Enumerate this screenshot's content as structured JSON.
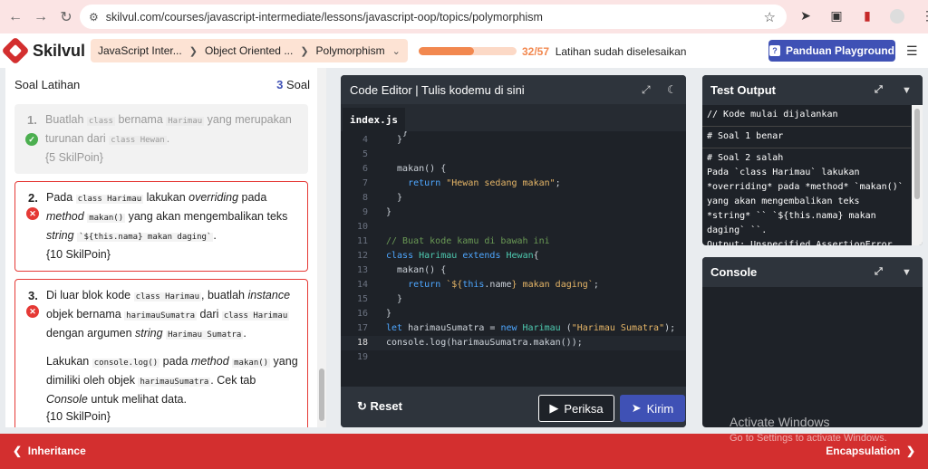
{
  "browser": {
    "url": "skilvul.com/courses/javascript-intermediate/lessons/javascript-oop/topics/polymorphism"
  },
  "header": {
    "brand": "Skilvul",
    "breadcrumbs": [
      "JavaScript Inter...",
      "Object Oriented ...",
      "Polymorphism"
    ],
    "progress": {
      "done": 32,
      "total": 57,
      "label": "32/57",
      "text": "Latihan sudah diselesaikan"
    },
    "guide_button": "Panduan Playground"
  },
  "exercises": {
    "title": "Soal Latihan",
    "count_num": "3",
    "count_label": "Soal"
  },
  "editor": {
    "title": "Code Editor | Tulis kodemu di sini",
    "tab": "index.js",
    "reset": "Reset",
    "check": "Periksa",
    "submit": "Kirim"
  },
  "test_output": {
    "title": "Test Output",
    "blocks": [
      [
        "// Kode mulai dijalankan"
      ],
      [
        "# Soal 1 benar"
      ],
      [
        "# Soal 2 salah",
        "Pada `class Harimau` lakukan",
        "*overriding* pada *method* `makan()`",
        "yang akan mengembalikan teks",
        "*string* `` `${this.nama} makan",
        "daging` ``.",
        "Output: Unspecified AssertionError"
      ]
    ]
  },
  "console": {
    "title": "Console"
  },
  "footer": {
    "prev": "Inheritance",
    "next": "Encapsulation"
  },
  "watermark": {
    "line1": "Activate Windows",
    "line2": "Go to Settings to activate Windows."
  },
  "colors": {
    "brand": "#d32f2f",
    "accent": "#3f51b5",
    "progress": "#f2884f",
    "success": "#4caf50",
    "error": "#e53935"
  }
}
